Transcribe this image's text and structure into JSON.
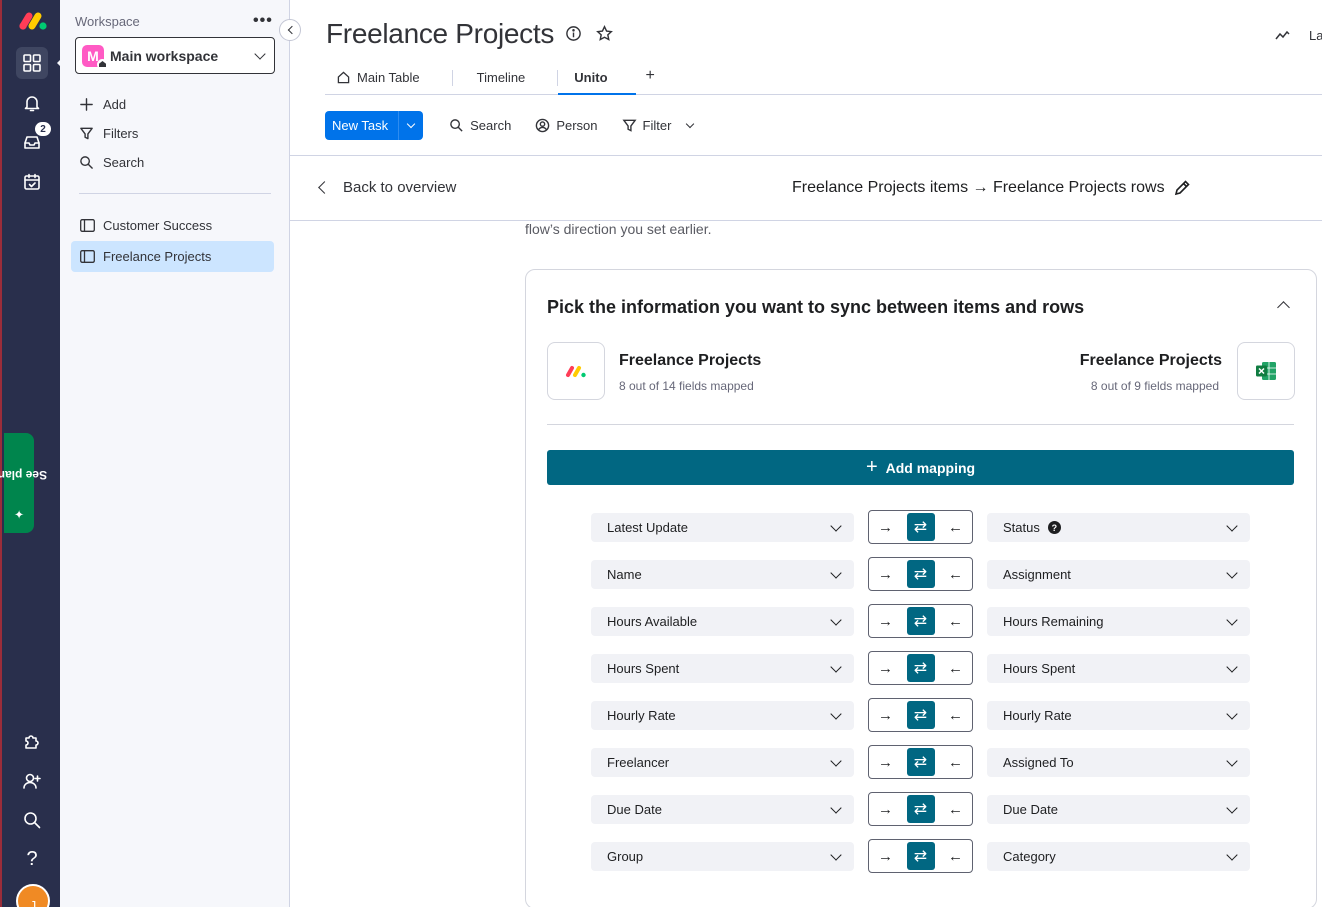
{
  "sidebar": {
    "workspace_label": "Workspace",
    "workspace_name": "Main workspace",
    "workspace_initial": "M",
    "actions": [
      {
        "label": "Add",
        "icon": "plus-icon"
      },
      {
        "label": "Filters",
        "icon": "filter-icon"
      },
      {
        "label": "Search",
        "icon": "search-icon"
      }
    ],
    "boards": [
      {
        "label": "Customer Success",
        "selected": false
      },
      {
        "label": "Freelance Projects",
        "selected": true
      }
    ]
  },
  "rail": {
    "notifications_badge": "2",
    "see_plans_label": "See plans",
    "avatar_initial": "J"
  },
  "header": {
    "title": "Freelance Projects",
    "top_right_text": "La",
    "tabs": [
      {
        "label": "Main Table",
        "icon": "home-icon",
        "active": false
      },
      {
        "label": "Timeline",
        "active": false
      },
      {
        "label": "Unito",
        "active": true
      }
    ],
    "add_tab_label": "+"
  },
  "toolbar": {
    "new_task_label": "New Task",
    "search_label": "Search",
    "person_label": "Person",
    "filter_label": "Filter"
  },
  "unito": {
    "back_label": "Back to overview",
    "flow_title": "Freelance Projects items → Freelance Projects rows",
    "cut_text": "flow’s direction you set earlier.",
    "card_title": "Pick the information you want to sync between items and rows",
    "left_app": {
      "name": "Freelance Projects",
      "sub": "8 out of 14 fields mapped",
      "icon": "monday-logo-icon"
    },
    "right_app": {
      "name": "Freelance Projects",
      "sub": "8 out of 9 fields mapped",
      "icon": "excel-icon"
    },
    "add_mapping_label": "Add mapping",
    "mappings": [
      {
        "left": "Latest Update",
        "right": "Status",
        "right_help": true
      },
      {
        "left": "Name",
        "right": "Assignment"
      },
      {
        "left": "Hours Available",
        "right": "Hours Remaining"
      },
      {
        "left": "Hours Spent",
        "right": "Hours Spent"
      },
      {
        "left": "Hourly Rate",
        "right": "Hourly Rate"
      },
      {
        "left": "Freelancer",
        "right": "Assigned To"
      },
      {
        "left": "Due Date",
        "right": "Due Date"
      },
      {
        "left": "Group",
        "right": "Category"
      }
    ],
    "direction_symbols": {
      "to_right": "→",
      "both": "⇄",
      "to_left": "←"
    },
    "help_symbol": "?"
  },
  "colors": {
    "rail_bg": "#292f4c",
    "primary_blue": "#0073ea",
    "unito_teal": "#016782",
    "selected_board_bg": "#cce5ff",
    "see_plans_green": "#00854d"
  }
}
